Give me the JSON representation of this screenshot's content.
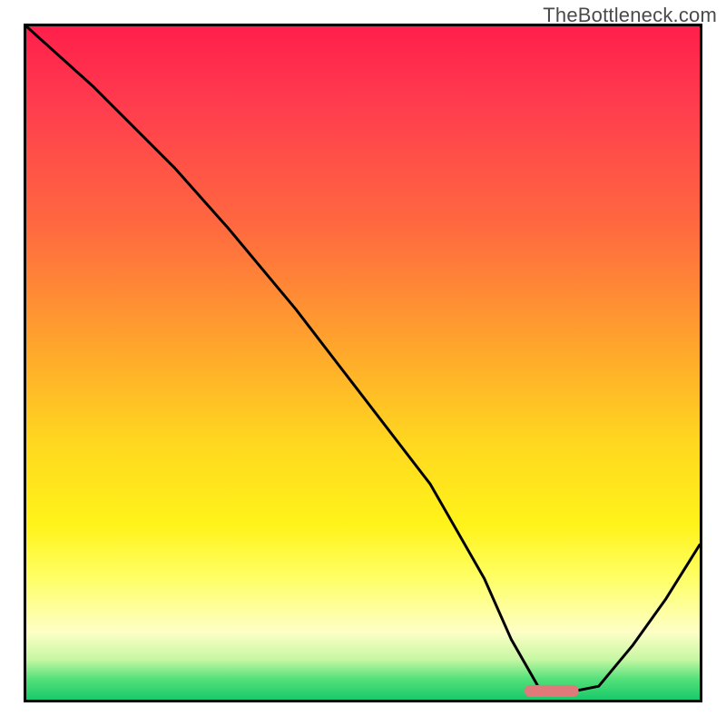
{
  "watermark": "TheBottleneck.com",
  "chart_data": {
    "type": "line",
    "title": "",
    "xlabel": "",
    "ylabel": "",
    "xlim": [
      0,
      100
    ],
    "ylim": [
      0,
      100
    ],
    "grid": false,
    "legend": false,
    "background_gradient": {
      "direction": "vertical",
      "stops": [
        {
          "pos": 0,
          "color": "#ff1f4b"
        },
        {
          "pos": 12,
          "color": "#ff3d4e"
        },
        {
          "pos": 30,
          "color": "#ff6a3f"
        },
        {
          "pos": 46,
          "color": "#ffa02e"
        },
        {
          "pos": 62,
          "color": "#ffd81f"
        },
        {
          "pos": 74,
          "color": "#fff31a"
        },
        {
          "pos": 82,
          "color": "#ffff66"
        },
        {
          "pos": 90,
          "color": "#fdffc6"
        },
        {
          "pos": 94,
          "color": "#c7f7a3"
        },
        {
          "pos": 97,
          "color": "#52e07a"
        },
        {
          "pos": 100,
          "color": "#18c96b"
        }
      ]
    },
    "series": [
      {
        "name": "bottleneck-curve",
        "x": [
          0,
          10,
          22,
          30,
          40,
          50,
          60,
          68,
          72,
          76,
          80,
          85,
          90,
          95,
          100
        ],
        "y": [
          100,
          91,
          79,
          70,
          58,
          45,
          32,
          18,
          9,
          2,
          1,
          2,
          8,
          15,
          23
        ]
      }
    ],
    "marker": {
      "name": "optimal-point",
      "x_center": 78,
      "width": 8,
      "y": 1.3,
      "color": "#e07a7a",
      "shape": "rounded-bar"
    }
  }
}
